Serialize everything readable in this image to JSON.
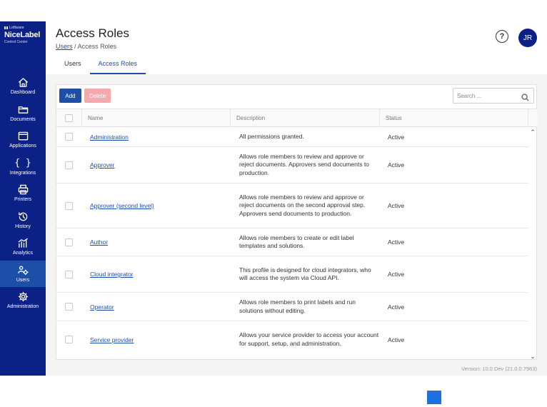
{
  "brand": {
    "company": "Loftware",
    "product": "NiceLabel",
    "subtitle": "Control Center"
  },
  "sidebar": {
    "items": [
      {
        "label": "Dashboard",
        "icon": "home-icon"
      },
      {
        "label": "Documents",
        "icon": "folder-icon"
      },
      {
        "label": "Applications",
        "icon": "window-icon"
      },
      {
        "label": "Integrations",
        "icon": "braces-icon"
      },
      {
        "label": "Printers",
        "icon": "printer-icon"
      },
      {
        "label": "History",
        "icon": "history-icon"
      },
      {
        "label": "Analytics",
        "icon": "chart-icon"
      },
      {
        "label": "Users",
        "icon": "users-gear-icon",
        "active": true
      },
      {
        "label": "Administration",
        "icon": "gear-icon"
      }
    ]
  },
  "header": {
    "title": "Access Roles",
    "breadcrumb": {
      "link": "Users",
      "separator": "/",
      "current": "Access Roles"
    },
    "help": "?",
    "avatar_initials": "JR"
  },
  "tabs": [
    {
      "label": "Users",
      "active": false
    },
    {
      "label": "Access Roles",
      "active": true
    }
  ],
  "toolbar": {
    "add_label": "Add",
    "delete_label": "Delete",
    "search_placeholder": "Search ..."
  },
  "table": {
    "columns": [
      "Name",
      "Description",
      "Status"
    ],
    "rows": [
      {
        "name": "Administration",
        "description": "All permissions granted.",
        "status": "Active"
      },
      {
        "name": "Approver",
        "description": "Allows role members to review and approve or reject documents. Approvers send documents to production.",
        "status": "Active"
      },
      {
        "name": "Approver (second level)",
        "description": "Allows role members to review and approve or reject documents on the second approval step. Approvers send documents to production.",
        "status": "Active"
      },
      {
        "name": "Author",
        "description": "Allows role members to create or edit label templates and solutions.",
        "status": "Active"
      },
      {
        "name": "Cloud integrator",
        "description": "This profile is designed for cloud integrators, who will access the system via Cloud API.",
        "status": "Active"
      },
      {
        "name": "Operator",
        "description": "Allows role members to print labels and run solutions without editing.",
        "status": "Active"
      },
      {
        "name": "Service provider",
        "description": "Allows your service provider to access your account for support, setup, and administration.",
        "status": "Active"
      }
    ]
  },
  "footer": {
    "version": "Version: 10.0 Dev (21.0.0.7963)"
  },
  "colors": {
    "sidebar": "#0b2185",
    "accent": "#1d4fa8",
    "delete": "#f3a9ad",
    "floating_square": "#1e6fe0"
  }
}
